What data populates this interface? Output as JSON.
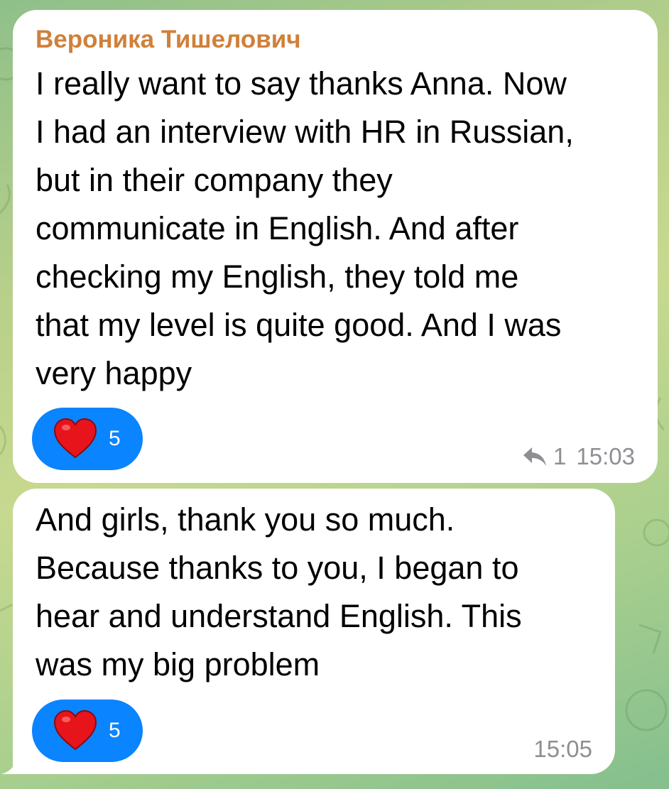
{
  "chat": {
    "messages": [
      {
        "sender": "Вероника Тишелович",
        "text": "I really want to say thanks Anna. Now\nI had an interview with HR in Russian,\nbut in their company they\ncommunicate in English. And after\nchecking my English, they told me\nthat my level is quite good. And I was\nvery happy",
        "reaction": {
          "icon": "heart-icon",
          "count": "5"
        },
        "reply_count": "1",
        "time": "15:03"
      },
      {
        "text": "And girls, thank you so much.\nBecause thanks to you, I began to\nhear and understand English. This\nwas my big problem",
        "reaction": {
          "icon": "heart-icon",
          "count": "5"
        },
        "time": "15:05"
      }
    ]
  },
  "colors": {
    "sender_name": "#d0803a",
    "reaction_bg": "#0a84ff",
    "heart": "#e8141c",
    "meta_text": "#8e8e93"
  }
}
